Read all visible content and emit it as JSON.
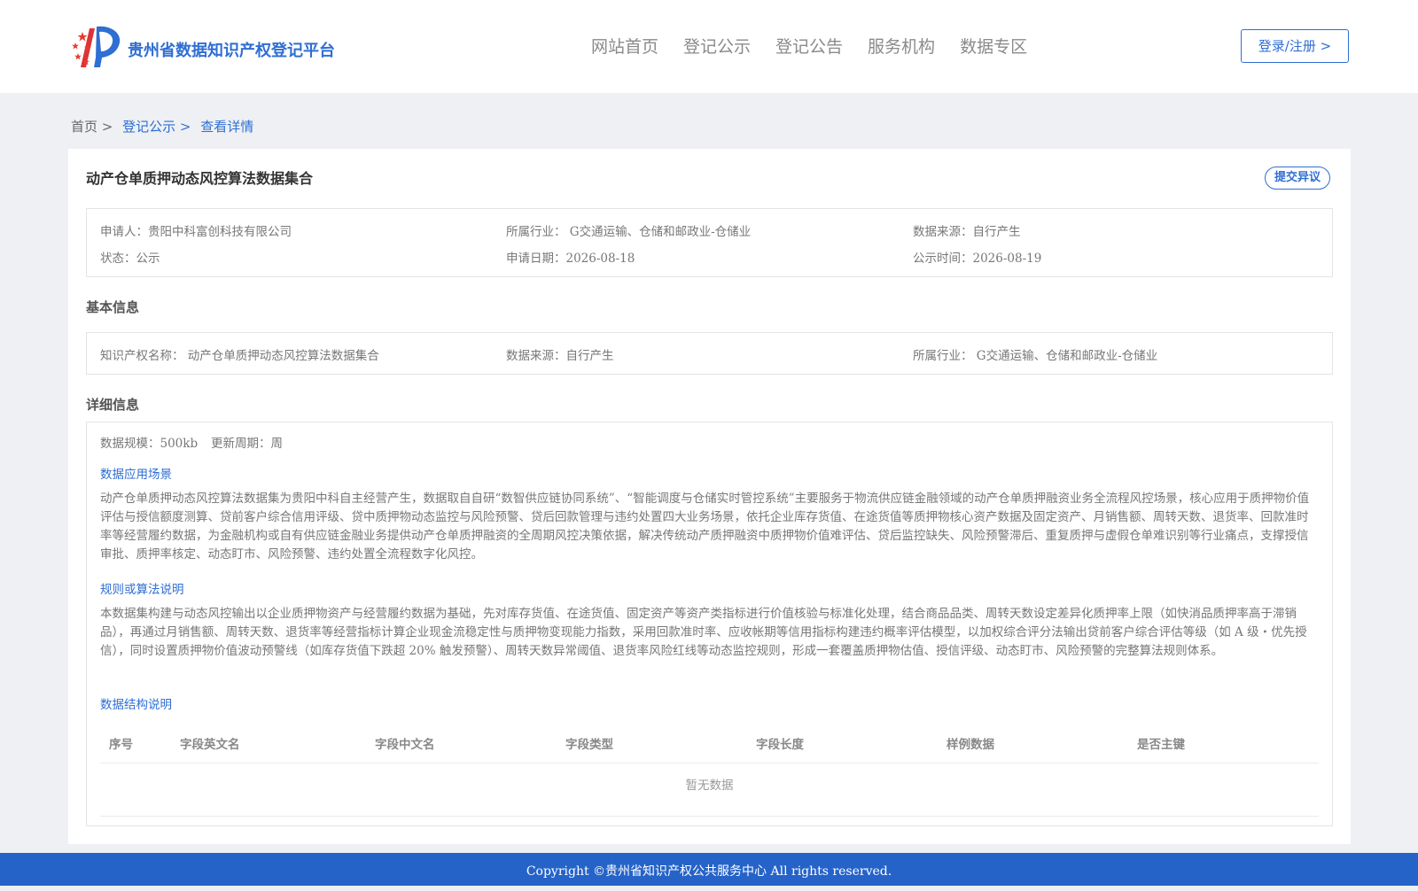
{
  "header": {
    "site_title": "贵州省数据知识产权登记平台",
    "nav": [
      "网站首页",
      "登记公示",
      "登记公告",
      "服务机构",
      "数据专区"
    ],
    "login": "登录/注册 >"
  },
  "breadcrumb": {
    "home": "首页 >",
    "list": "登记公示 >",
    "current": "查看详情"
  },
  "item": {
    "title": "动产仓单质押动态风控算法数据集合",
    "objection": "提交异议",
    "applicant": "申请人：贵阳中科富创科技有限公司",
    "industry": "所属行业： G交通运输、仓储和邮政业-仓储业",
    "source": "数据来源：自行产生",
    "status": "状态：公示",
    "apply_date": "申请日期：2026-08-18",
    "publish_date": "公示时间：2026-08-19"
  },
  "basic": {
    "title": "基本信息",
    "name": "知识产权名称： 动产仓单质押动态风控算法数据集合",
    "source": "数据来源：自行产生",
    "industry": "所属行业： G交通运输、仓储和邮政业-仓储业"
  },
  "detail": {
    "title": "详细信息",
    "scale": "数据规模：500kb",
    "cycle": "更新周期：周",
    "scene_label": "数据应用场景",
    "scene_text": "动产仓单质押动态风控算法数据集为贵阳中科自主经营产生，数据取自自研“数智供应链协同系统”、“智能调度与仓储实时管控系统”主要服务于物流供应链金融领域的动产仓单质押融资业务全流程风控场景，核心应用于质押物价值评估与授信额度测算、贷前客户综合信用评级、贷中质押物动态监控与风险预警、贷后回款管理与违约处置四大业务场景，依托企业库存货值、在途货值等质押物核心资产数据及固定资产、月销售额、周转天数、退货率、回款准时率等经营履约数据，为金融机构或自有供应链金融业务提供动产仓单质押融资的全周期风控决策依据，解决传统动产质押融资中质押物价值难评估、贷后监控缺失、风险预警滞后、重复质押与虚假仓单难识别等行业痛点，支撑授信审批、质押率核定、动态盯市、风险预警、违约处置全流程数字化风控。",
    "rule_label": "规则或算法说明",
    "rule_text": "本数据集构建与动态风控输出以企业质押物资产与经营履约数据为基础，先对库存货值、在途货值、固定资产等资产类指标进行价值核验与标准化处理，结合商品品类、周转天数设定差异化质押率上限（如快消品质押率高于滞销品），再通过月销售额、周转天数、退货率等经营指标计算企业现金流稳定性与质押物变现能力指数，采用回款准时率、应收帐期等信用指标构建违约概率评估模型，以加权综合评分法输出贷前客户综合评估等级（如 A 级・优先授信），同时设置质押物价值波动预警线（如库存货值下跌超 20% 触发预警）、周转天数异常阈值、退货率风险红线等动态监控规则，形成一套覆盖质押物估值、授信评级、动态盯市、风险预警的完整算法规则体系。",
    "struct_label": "数据结构说明",
    "table_headers": [
      "序号",
      "字段英文名",
      "字段中文名",
      "字段类型",
      "字段长度",
      "样例数据",
      "是否主键"
    ],
    "empty_text": "暂无数据"
  },
  "footer": "Copyright ©贵州省知识产权公共服务中心 All rights reserved.",
  "colors": {
    "accent": "#2f6ed3",
    "footer_bg": "#2563c9",
    "page_bg": "#eef0f3"
  }
}
